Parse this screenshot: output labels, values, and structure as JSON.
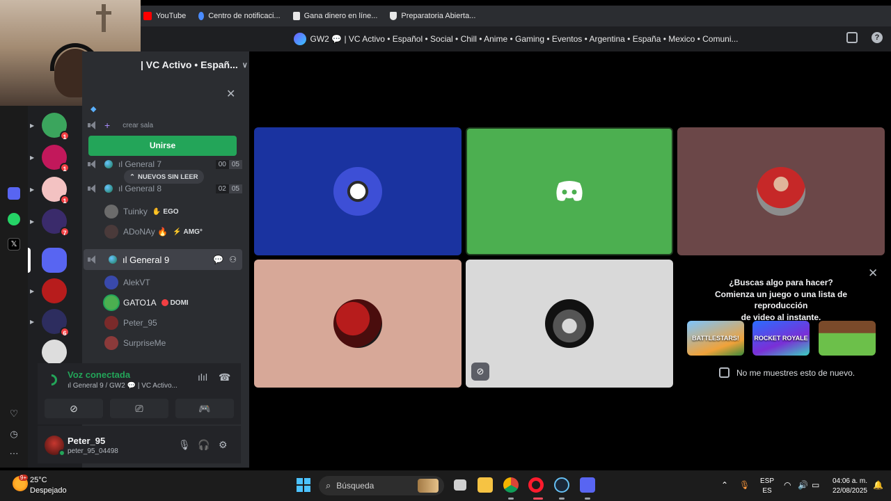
{
  "browser": {
    "bookmarks": [
      {
        "label": "YouTube",
        "icon": "youtube-icon",
        "color": "#ff0000"
      },
      {
        "label": "Centro de notificaci...",
        "icon": "info-icon",
        "color": "#4a8cff"
      },
      {
        "label": "Gana dinero en líne...",
        "icon": "document-icon",
        "color": "#e8e8e8"
      },
      {
        "label": "Preparatoria Abierta...",
        "icon": "shield-icon",
        "color": "#e8e8e8"
      }
    ]
  },
  "titlebar": {
    "text": "GW2 💬 | VC Activo • Español • Social • Chill • Anime • Gaming • Eventos • Argentina • España • Mexico • Comuni..."
  },
  "sidebar": {
    "server_name": "| VC Activo • Españ...",
    "crear_sala": "crear sala",
    "join_button": "Unirse",
    "unread_pill": "NUEVOS SIN LEER",
    "channels": [
      {
        "name": "ıl General 7",
        "count_a": "00",
        "count_b": "05"
      },
      {
        "name": "ıl General 8",
        "count_a": "02",
        "count_b": "05"
      },
      {
        "name": "ıl General 9"
      }
    ],
    "g8_users": [
      {
        "name": "Tuinky",
        "tag": "EGO"
      },
      {
        "name": "ADoNAy 🔥",
        "tag": "AMG°"
      }
    ],
    "g9_users": [
      {
        "name": "AlekVT",
        "tag": ""
      },
      {
        "name": "GATO1A",
        "tag": "DOMI"
      },
      {
        "name": "Peter_95",
        "tag": ""
      },
      {
        "name": "SurpriseMe",
        "tag": ""
      }
    ]
  },
  "voice": {
    "status": "Voz conectada",
    "location": "ıl General 9 / GW2 💬 | VC Activo..."
  },
  "user": {
    "name": "Peter_95",
    "handle": "peter_95_04498"
  },
  "servers": [
    {
      "badge": "1",
      "color": "#3ba55d"
    },
    {
      "badge": "1",
      "color": "#c2185b"
    },
    {
      "badge": "1",
      "color": "#f3c2c2"
    },
    {
      "badge": "7",
      "color": "#3a2b6b"
    },
    {
      "badge": "",
      "color": "#5865f2"
    },
    {
      "badge": "",
      "color": "#b71c1c"
    },
    {
      "badge": "6",
      "color": "#2d2d5f"
    },
    {
      "badge": "",
      "color": "#dddddd"
    }
  ],
  "activity": {
    "line1": "¿Buscas algo para hacer?",
    "line2": "Comienza un juego o una lista de reproducción",
    "line3": "de video al instante.",
    "games": [
      "BATTLESTARS!",
      "ROCKET ROYALE",
      ""
    ],
    "dont_show": "No me muestres esto de nuevo."
  },
  "taskbar": {
    "temperature": "25°C",
    "condition": "Despejado",
    "weather_badge": "9+",
    "search": "Búsqueda",
    "lang_top": "ESP",
    "lang_bottom": "ES",
    "time": "04:06 a. m.",
    "date": "22/08/2025"
  },
  "colors": {
    "join_green": "#23a559",
    "tile_blue": "#1a33a0",
    "tile_green": "#4caf50",
    "tile_maroon": "#6b4748",
    "tile_peach": "#d7a898",
    "tile_gray": "#d9d9d9"
  }
}
